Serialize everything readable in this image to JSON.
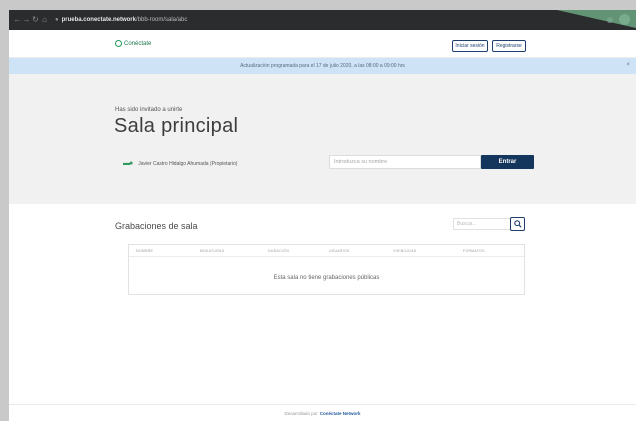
{
  "browser": {
    "url_domain": "prueba.conectate.network",
    "url_path": "/bbb-room/sala/abc"
  },
  "header": {
    "logo_text": "Conéctate",
    "login_label": "Iniciar sesión",
    "register_label": "Registrarse"
  },
  "banner": {
    "text": "Actualización programada para el 17 de julio 2020, a las 08:00 a 09:00 hrs"
  },
  "hero": {
    "subtitle": "Has sido invitado a unirte",
    "title": "Sala principal",
    "owner": "Javier Castro Hidalgo Ahumada (Propietario)",
    "name_placeholder": "Introduzca su nombre",
    "enter_label": "Entrar"
  },
  "recordings": {
    "title": "Grabaciones de sala",
    "search_placeholder": "Buscar...",
    "columns": [
      "Nombre",
      "Miniaturas",
      "Duración",
      "Usuarios",
      "Visibilidad",
      "Formatos"
    ],
    "empty_text": "Esta sala no tiene grabaciones públicas"
  },
  "footer": {
    "prefix": "Desarrollado por",
    "brand": "Conéctate Network"
  }
}
